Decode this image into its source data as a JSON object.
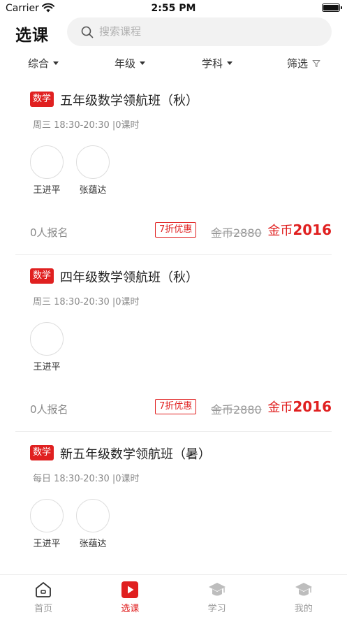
{
  "status": {
    "carrier": "Carrier",
    "time": "2:55 PM"
  },
  "header": {
    "title": "选课",
    "search_placeholder": "搜索课程"
  },
  "filters": [
    {
      "label": "综合",
      "icon": "caret-down-icon"
    },
    {
      "label": "年级",
      "icon": "caret-down-icon"
    },
    {
      "label": "学科",
      "icon": "caret-down-icon"
    },
    {
      "label": "筛选",
      "icon": "funnel-icon"
    }
  ],
  "courses": [
    {
      "subject": "数学",
      "title": "五年级数学领航班（秋）",
      "time": "周三 18:30-20:30 |0课时",
      "teachers": [
        "王进平",
        "张蕴达"
      ],
      "enrolled": "0人报名",
      "discount": "7折优惠",
      "orig_price": "金币2880",
      "price_unit": "金币",
      "price": "2016"
    },
    {
      "subject": "数学",
      "title": "四年级数学领航班（秋）",
      "time": "周三 18:30-20:30 |0课时",
      "teachers": [
        "王进平"
      ],
      "enrolled": "0人报名",
      "discount": "7折优惠",
      "orig_price": "金币2880",
      "price_unit": "金币",
      "price": "2016"
    },
    {
      "subject": "数学",
      "title": "新五年级数学领航班（暑）",
      "time": "每日 18:30-20:30 |0课时",
      "teachers": [
        "王进平",
        "张蕴达"
      ]
    }
  ],
  "tabs": [
    {
      "label": "首页",
      "icon": "home-icon",
      "active": false
    },
    {
      "label": "选课",
      "icon": "play-icon",
      "active": true
    },
    {
      "label": "学习",
      "icon": "graduation-cap-icon",
      "active": false
    },
    {
      "label": "我的",
      "icon": "graduation-cap-icon",
      "active": false
    }
  ],
  "colors": {
    "accent": "#e02020",
    "muted": "#999999"
  }
}
